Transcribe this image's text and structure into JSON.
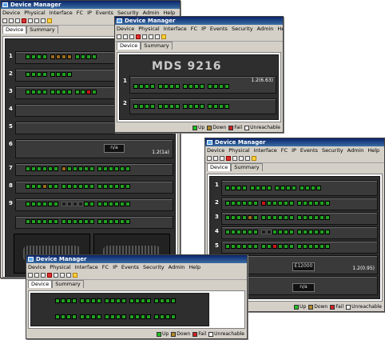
{
  "app_title": "Device Manager",
  "menu": [
    "Device",
    "Physical",
    "Interface",
    "FC",
    "IP",
    "Events",
    "Security",
    "Admin",
    "Help"
  ],
  "tabs": [
    "Device",
    "Summary"
  ],
  "legend": [
    "Up",
    "Down",
    "Fail",
    "Unreachable"
  ],
  "colors": {
    "up": "#22c022",
    "down": "#b08a2a",
    "fail": "#d02020",
    "unreachable": "#ffffff"
  },
  "mds_logo": "MDS 9216",
  "module_labels": {
    "w2_slot1_id": "1.2(6.63)",
    "w2_slot1": "1",
    "w2_slot2": "2",
    "w1_slots": [
      "1",
      "2",
      "3",
      "4",
      "5",
      "6",
      "7",
      "8",
      "9"
    ],
    "w1_sup_id": "1.2(1a)",
    "w1_sup2_label": "n/a",
    "w3_slots": [
      "1",
      "2",
      "3",
      "4",
      "5",
      "6"
    ],
    "w3_sup_label": "E12000",
    "w3_sup2_label": "n/a",
    "w3_sup_id": "1.2(0.95)"
  },
  "toolbar_icons": [
    "open-icon",
    "refresh-icon",
    "chart-icon",
    "gear-icon",
    "delete-icon",
    "help-icon"
  ]
}
